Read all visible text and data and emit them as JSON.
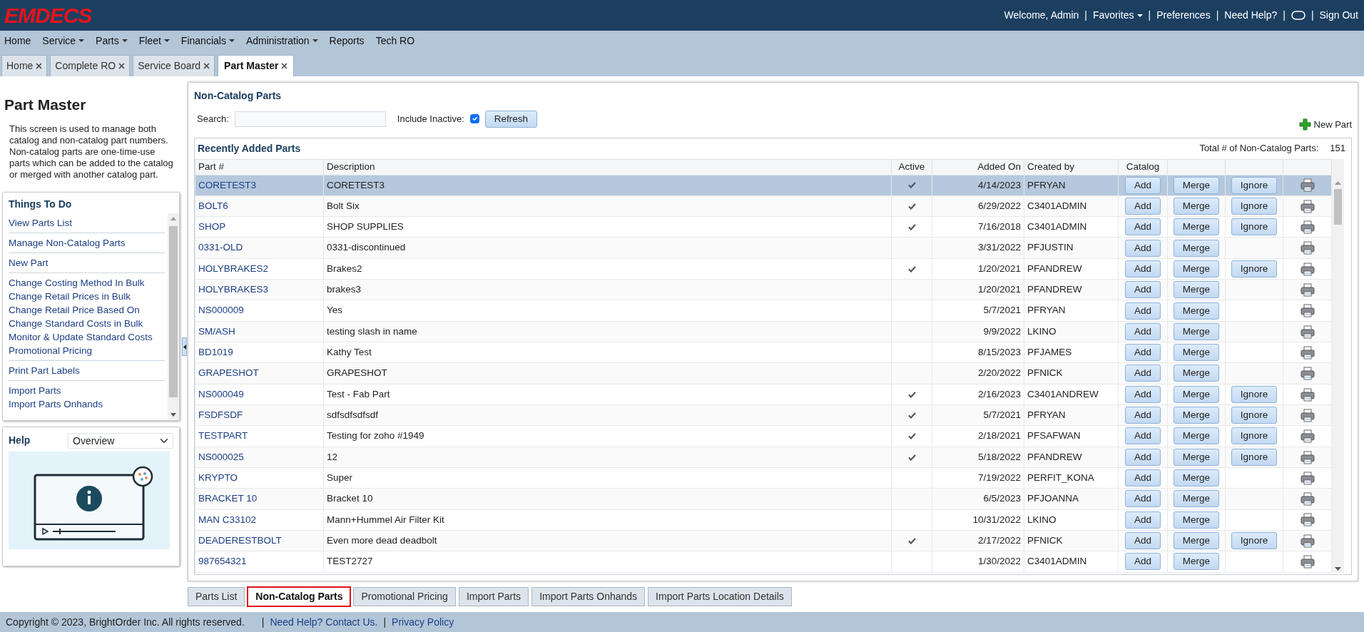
{
  "header": {
    "logo": "EMDECS",
    "links": [
      {
        "kind": "text",
        "label": "Welcome, Admin"
      },
      {
        "kind": "separator",
        "label": "|"
      },
      {
        "kind": "dropdown",
        "label": "Favorites"
      },
      {
        "kind": "separator",
        "label": "|"
      },
      {
        "kind": "link",
        "label": "Preferences"
      },
      {
        "kind": "separator",
        "label": "|"
      },
      {
        "kind": "link",
        "label": "Need Help?"
      },
      {
        "kind": "separator",
        "label": "|"
      },
      {
        "kind": "icon"
      },
      {
        "kind": "separator",
        "label": "|"
      },
      {
        "kind": "link",
        "label": "Sign Out"
      }
    ]
  },
  "menu": [
    {
      "label": "Home",
      "dropdown": false
    },
    {
      "label": "Service",
      "dropdown": true
    },
    {
      "label": "Parts",
      "dropdown": true
    },
    {
      "label": "Fleet",
      "dropdown": true
    },
    {
      "label": "Financials",
      "dropdown": true
    },
    {
      "label": "Administration",
      "dropdown": true
    },
    {
      "label": "Reports",
      "dropdown": false
    },
    {
      "label": "Tech RO",
      "dropdown": false
    }
  ],
  "tabs": [
    {
      "label": "Home",
      "selected": false
    },
    {
      "label": "Complete RO",
      "selected": false
    },
    {
      "label": "Service Board",
      "selected": false
    },
    {
      "label": "Part Master",
      "selected": true
    }
  ],
  "sidebar": {
    "title": "Part Master",
    "description": "This screen is used to manage both catalog and non-catalog part numbers. Non-catalog parts are one-time-use parts which can be added to the catalog or merged with another catalog part.",
    "things_to_do": {
      "title": "Things To Do",
      "groups": [
        [
          "View Parts List"
        ],
        [
          "Manage Non-Catalog Parts"
        ],
        [
          "New Part"
        ],
        [
          "Change Costing Method In Bulk",
          "Change Retail Prices in Bulk",
          "Change Retail Price Based On",
          "Change Standard Costs in Bulk",
          "Monitor & Update Standard Costs",
          "Promotional Pricing"
        ],
        [
          "Print Part Labels"
        ],
        [
          "Import Parts",
          "Import Parts Onhands"
        ]
      ]
    },
    "help": {
      "title": "Help",
      "topic": "Overview"
    }
  },
  "panel": {
    "title": "Non-Catalog Parts",
    "search_label": "Search:",
    "include_inactive_label": "Include Inactive:",
    "include_inactive": true,
    "refresh": "Refresh",
    "new_part": "New Part",
    "grid": {
      "title": "Recently Added Parts",
      "total_label": "Total # of Non-Catalog Parts:",
      "total": "151",
      "columns": [
        "Part #",
        "Description",
        "Active",
        "Added On",
        "Created by",
        "Catalog"
      ],
      "rows": [
        {
          "part": "CORETEST3",
          "description": "CORETEST3",
          "active": true,
          "added_on": "4/14/2023",
          "created_by": "PFRYAN",
          "add": "Add",
          "merge": "Merge",
          "ignore": "Ignore",
          "selected": true
        },
        {
          "part": "BOLT6",
          "description": "Bolt Six",
          "active": true,
          "added_on": "6/29/2022",
          "created_by": "C3401ADMIN",
          "add": "Add",
          "merge": "Merge",
          "ignore": "Ignore",
          "selected": false
        },
        {
          "part": "SHOP",
          "description": "SHOP SUPPLIES",
          "active": true,
          "added_on": "7/16/2018",
          "created_by": "C3401ADMIN",
          "add": "Add",
          "merge": "Merge",
          "ignore": "Ignore",
          "selected": false
        },
        {
          "part": "0331-OLD",
          "description": "0331-discontinued",
          "active": false,
          "added_on": "3/31/2022",
          "created_by": "PFJUSTIN",
          "add": "Add",
          "merge": "Merge",
          "selected": false
        },
        {
          "part": "HOLYBRAKES2",
          "description": "Brakes2",
          "active": true,
          "added_on": "1/20/2021",
          "created_by": "PFANDREW",
          "add": "Add",
          "merge": "Merge",
          "ignore": "Ignore",
          "selected": false
        },
        {
          "part": "HOLYBRAKES3",
          "description": "brakes3",
          "active": false,
          "added_on": "1/20/2021",
          "created_by": "PFANDREW",
          "add": "Add",
          "merge": "Merge",
          "selected": false
        },
        {
          "part": "NS000009",
          "description": "Yes",
          "active": false,
          "added_on": "5/7/2021",
          "created_by": "PFRYAN",
          "add": "Add",
          "merge": "Merge",
          "selected": false
        },
        {
          "part": "SM/ASH",
          "description": "testing slash in name",
          "active": false,
          "added_on": "9/9/2022",
          "created_by": "LKINO",
          "add": "Add",
          "merge": "Merge",
          "selected": false
        },
        {
          "part": "BD1019",
          "description": "Kathy Test",
          "active": false,
          "added_on": "8/15/2023",
          "created_by": "PFJAMES",
          "add": "Add",
          "merge": "Merge",
          "selected": false
        },
        {
          "part": "GRAPESHOT",
          "description": "GRAPESHOT",
          "active": false,
          "added_on": "2/20/2022",
          "created_by": "PFNICK",
          "add": "Add",
          "merge": "Merge",
          "selected": false
        },
        {
          "part": "NS000049",
          "description": "Test - Fab Part",
          "active": true,
          "added_on": "2/16/2023",
          "created_by": "C3401ANDREW",
          "add": "Add",
          "merge": "Merge",
          "ignore": "Ignore",
          "selected": false
        },
        {
          "part": "FSDFSDF",
          "description": "sdfsdfsdfsdf",
          "active": true,
          "added_on": "5/7/2021",
          "created_by": "PFRYAN",
          "add": "Add",
          "merge": "Merge",
          "ignore": "Ignore",
          "selected": false
        },
        {
          "part": "TESTPART",
          "description": "Testing for zoho #1949",
          "active": true,
          "added_on": "2/18/2021",
          "created_by": "PFSAFWAN",
          "add": "Add",
          "merge": "Merge",
          "ignore": "Ignore",
          "selected": false
        },
        {
          "part": "NS000025",
          "description": "12",
          "active": true,
          "added_on": "5/18/2022",
          "created_by": "PFANDREW",
          "add": "Add",
          "merge": "Merge",
          "ignore": "Ignore",
          "selected": false
        },
        {
          "part": "KRYPTO",
          "description": "Super",
          "active": false,
          "added_on": "7/19/2022",
          "created_by": "PERFIT_KONA",
          "add": "Add",
          "merge": "Merge",
          "selected": false
        },
        {
          "part": "BRACKET 10",
          "description": "Bracket 10",
          "active": false,
          "added_on": "6/5/2023",
          "created_by": "PFJOANNA",
          "add": "Add",
          "merge": "Merge",
          "selected": false
        },
        {
          "part": "MAN C33102",
          "description": "Mann+Hummel Air Filter Kit",
          "active": false,
          "added_on": "10/31/2022",
          "created_by": "LKINO",
          "add": "Add",
          "merge": "Merge",
          "selected": false
        },
        {
          "part": "DEADERESTBOLT",
          "description": "Even more dead deadbolt",
          "active": true,
          "added_on": "2/17/2022",
          "created_by": "PFNICK",
          "add": "Add",
          "merge": "Merge",
          "ignore": "Ignore",
          "selected": false
        },
        {
          "part": "987654321",
          "description": "TEST2727",
          "active": false,
          "added_on": "1/30/2022",
          "created_by": "C3401ADMIN",
          "add": "Add",
          "merge": "Merge",
          "selected": false
        }
      ]
    }
  },
  "bottom_tabs": [
    {
      "label": "Parts List",
      "selected": false
    },
    {
      "label": "Non-Catalog Parts",
      "selected": true
    },
    {
      "label": "Promotional Pricing",
      "selected": false
    },
    {
      "label": "Import Parts",
      "selected": false
    },
    {
      "label": "Import Parts Onhands",
      "selected": false
    },
    {
      "label": "Import Parts Location Details",
      "selected": false
    }
  ],
  "footer": [
    {
      "kind": "text",
      "label": "Copyright © 2023, BrightOrder Inc. All rights reserved."
    },
    {
      "kind": "separator",
      "label": "|"
    },
    {
      "kind": "link",
      "label": "Need Help? Contact Us."
    },
    {
      "kind": "separator",
      "label": "|"
    },
    {
      "kind": "link",
      "label": "Privacy Policy"
    }
  ]
}
